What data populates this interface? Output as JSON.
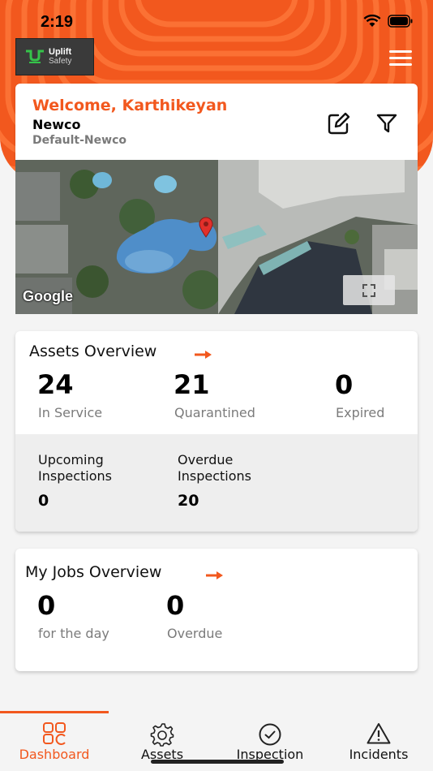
{
  "colors": {
    "accent": "#f2581e",
    "background": "#f4f4f4",
    "panel": "#eeeeee"
  },
  "status_bar": {
    "time": "2:19",
    "icons": [
      "wifi-icon",
      "battery-icon"
    ]
  },
  "header": {
    "logo": {
      "line1": "Uplift",
      "line2": "Safety"
    },
    "menu_icon": "hamburger-menu-icon"
  },
  "welcome": {
    "title": "Welcome, Karthikeyan",
    "company": "Newco",
    "subcompany": "Default-Newco",
    "actions": [
      "edit-icon",
      "filter-icon"
    ]
  },
  "map": {
    "attribution": "Google",
    "fullscreen_icon": "fullscreen-icon",
    "marker_icon": "map-pin-icon"
  },
  "assets_overview": {
    "title": "Assets Overview",
    "stats": [
      {
        "value": "24",
        "label": "In Service"
      },
      {
        "value": "21",
        "label": "Quarantined"
      },
      {
        "value": "0",
        "label": "Expired"
      }
    ],
    "inspections": [
      {
        "label_line1": "Upcoming",
        "label_line2": "Inspections",
        "value": "0"
      },
      {
        "label_line1": "Overdue",
        "label_line2": "Inspections",
        "value": "20"
      }
    ]
  },
  "jobs_overview": {
    "title": "My Jobs Overview",
    "stats": [
      {
        "value": "0",
        "label": "for the day"
      },
      {
        "value": "0",
        "label": "Overdue"
      }
    ]
  },
  "bottom_nav": {
    "active_index": 0,
    "items": [
      {
        "label": "Dashboard",
        "icon": "dashboard-grid-icon"
      },
      {
        "label": "Assets",
        "icon": "gear-icon"
      },
      {
        "label": "Inspection",
        "icon": "check-circle-icon"
      },
      {
        "label": "Incidents",
        "icon": "warning-triangle-icon"
      }
    ]
  }
}
